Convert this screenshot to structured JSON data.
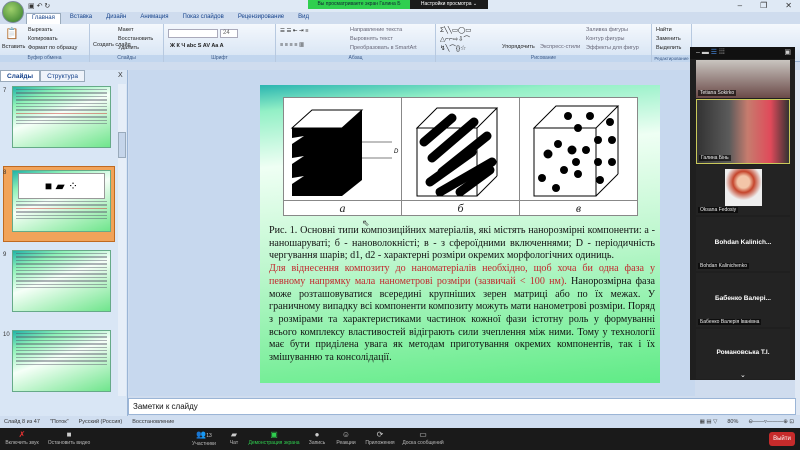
{
  "qat": {
    "icons": [
      "save-icon",
      "undo-icon",
      "redo-icon"
    ]
  },
  "share": {
    "banner": "Вы просматриваете экран Галина Б",
    "view_settings": "Настройки просмотра ⌄"
  },
  "tabs": [
    "Главная",
    "Вставка",
    "Дизайн",
    "Анимация",
    "Показ слайдов",
    "Рецензирование",
    "Вид"
  ],
  "ribbon": {
    "clipboard": {
      "paste": "Вставить",
      "cut": "Вырезать",
      "copy": "Копировать",
      "format": "Формат по образцу",
      "label": "Буфер обмена"
    },
    "slides": {
      "new": "Создать слайд",
      "layout": "Макет",
      "reset": "Восстановить",
      "delete": "Удалить",
      "label": "Слайды"
    },
    "font": {
      "size": "24",
      "label": "Шрифт"
    },
    "paragraph": {
      "direction": "Направление текста",
      "align": "Выровнять текст",
      "smartart": "Преобразовать в SmartArt",
      "label": "Абзац"
    },
    "drawing": {
      "arrange": "Упорядочить",
      "styles": "Экспресс-стили",
      "fill": "Заливка фигуры",
      "outline": "Контур фигуры",
      "effects": "Эффекты для фигур",
      "label": "Рисование"
    },
    "editing": {
      "find": "Найти",
      "replace": "Заменить",
      "select": "Выделить",
      "label": "Редактирование"
    }
  },
  "panel": {
    "tabs": [
      "Слайды",
      "Структура"
    ],
    "close": "X",
    "thumbs": [
      "7",
      "8",
      "9",
      "10"
    ]
  },
  "slide": {
    "figure_labels": [
      "а",
      "б",
      "в"
    ],
    "caption": "Рис. 1. Основні типи композиційних матеріалів, які містять нанорозмірні компоненти: а - наношаруваті; б - нановолокністі; в - з сфероїдними включеннями; D - періодичність чергування шарів; d1, d2 - характерні розміри окремих морфологічних одиниць.",
    "para_red": "Для віднесення композиту до наноматеріалів необхідно, щоб хоча би одна фаза у певному напрямку мала нанометрові розміри (зазвичай < 100 нм).",
    "para_rest": " Нанорозмірна фаза може розташовуватися всередині крупніших зерен матриці або по їх межах. У граничному випадку всі компоненти композиту можуть мати нанометрові розміри. Поряд з розмірами та характеристиками частинок кожної фази істотну роль у формуванні всього комплексу властивостей відіграють сили зчеплення між ними. Тому у технології має бути приділена увага як методам приготування окремих компонентів, так і їх змішуванню та консолідації."
  },
  "participants": [
    {
      "name": "Tetiana Sokirko"
    },
    {
      "name": "Галина Бінь"
    },
    {
      "name": "Oksana Fedosiy"
    },
    {
      "display": "Bohdan Kalinich...",
      "name": "Bohdan Kalinichenko"
    },
    {
      "display": "Бабенко Валері...",
      "name": "Бабенко Валерія Іванівна"
    },
    {
      "display": "Романовська Т.І."
    }
  ],
  "notes": "Заметки к слайду",
  "status": {
    "slide": "Слайд 8 из 47",
    "theme": "\"Поток\"",
    "lang": "Русский (Россия)",
    "mode": "Восстановление",
    "zoom": "80%"
  },
  "zoom_toolbar": {
    "mute": "Включить звук",
    "video": "Остановить видео",
    "participants": "Участники",
    "count": "13",
    "chat": "Чат",
    "share": "Демонстрация экрана",
    "record": "Запись",
    "reactions": "Реакции",
    "apps": "Приложения",
    "whiteboard": "Доска сообщений",
    "leave": "Выйти"
  },
  "colors": {
    "share_green": "#2fcf4f",
    "leave_red": "#c62b2b",
    "slide_red": "#c2272d"
  }
}
